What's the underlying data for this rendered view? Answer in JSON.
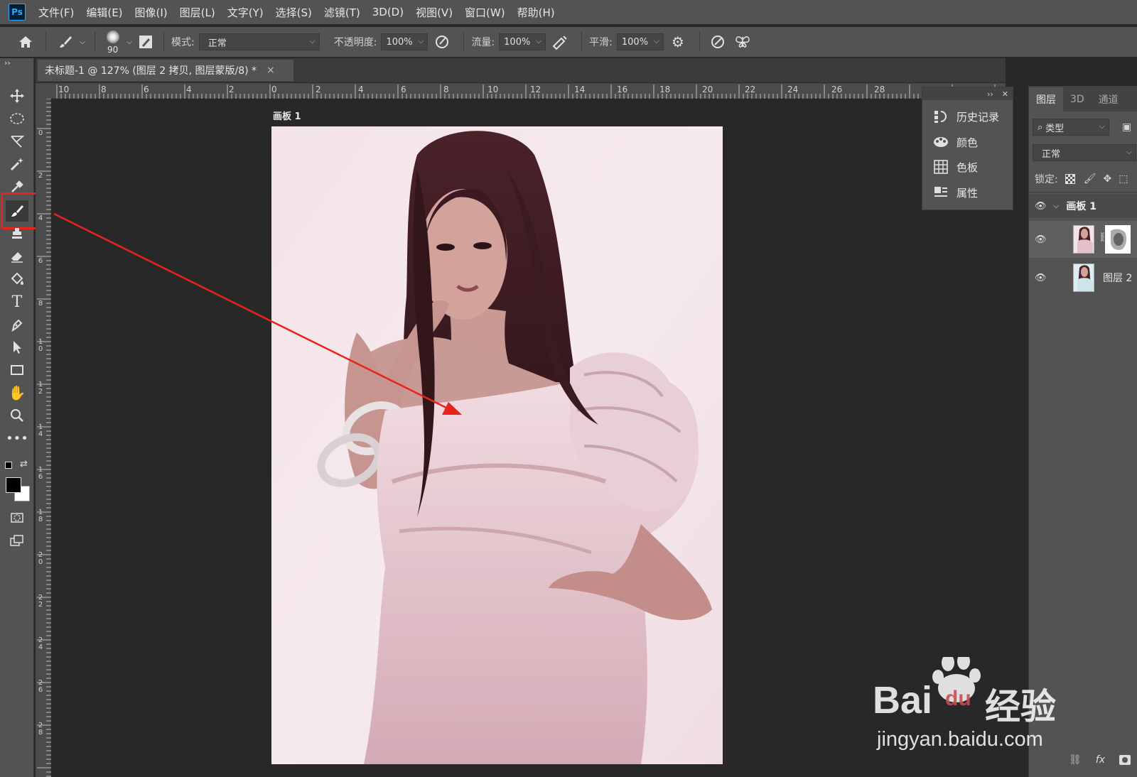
{
  "menubar": {
    "logo": "Ps",
    "items": [
      "文件(F)",
      "编辑(E)",
      "图像(I)",
      "图层(L)",
      "文字(Y)",
      "选择(S)",
      "滤镜(T)",
      "3D(D)",
      "视图(V)",
      "窗口(W)",
      "帮助(H)"
    ]
  },
  "options": {
    "brush_size": "90",
    "mode_label": "模式:",
    "mode_value": "正常",
    "opacity_label": "不透明度:",
    "opacity_value": "100%",
    "flow_label": "流量:",
    "flow_value": "100%",
    "smooth_label": "平滑:",
    "smooth_value": "100%"
  },
  "document": {
    "tab_title": "未标题-1 @ 127% (图层 2 拷贝, 图层蒙版/8) *",
    "close": "×",
    "artboard_label": "画板 1"
  },
  "rulers": {
    "h_labels": [
      "10",
      "8",
      "6",
      "4",
      "2",
      "0",
      "2",
      "4",
      "6",
      "8",
      "10",
      "12",
      "14",
      "16",
      "18",
      "20",
      "22",
      "24",
      "26",
      "28"
    ],
    "v_labels": [
      "0",
      "2",
      "4",
      "6",
      "8",
      "1 0",
      "1 2",
      "1 4",
      "1 6",
      "1 8",
      "2 0",
      "2 2",
      "2 4",
      "2 6",
      "2 8"
    ]
  },
  "float_panel": {
    "items": [
      {
        "label": "历史记录",
        "icon": "history-icon"
      },
      {
        "label": "颜色",
        "icon": "palette-icon"
      },
      {
        "label": "色板",
        "icon": "swatches-icon"
      },
      {
        "label": "属性",
        "icon": "properties-icon"
      }
    ]
  },
  "layers_panel": {
    "tabs": [
      "图层",
      "3D",
      "通道"
    ],
    "filter_label": "类型",
    "blend_mode": "正常",
    "lock_label": "锁定:",
    "group_name": "画板 1",
    "layer2_name": "图层 2",
    "footer_fx": "fx"
  },
  "watermark": {
    "brand": "Bai",
    "brand_paw": "du",
    "brand_cn": "经验",
    "url": "jingyan.baidu.com"
  },
  "colors": {
    "highlight": "#e8231c",
    "arrow": "#e8231c",
    "panel_bg": "#535353",
    "canvas_bg": "#282828"
  }
}
